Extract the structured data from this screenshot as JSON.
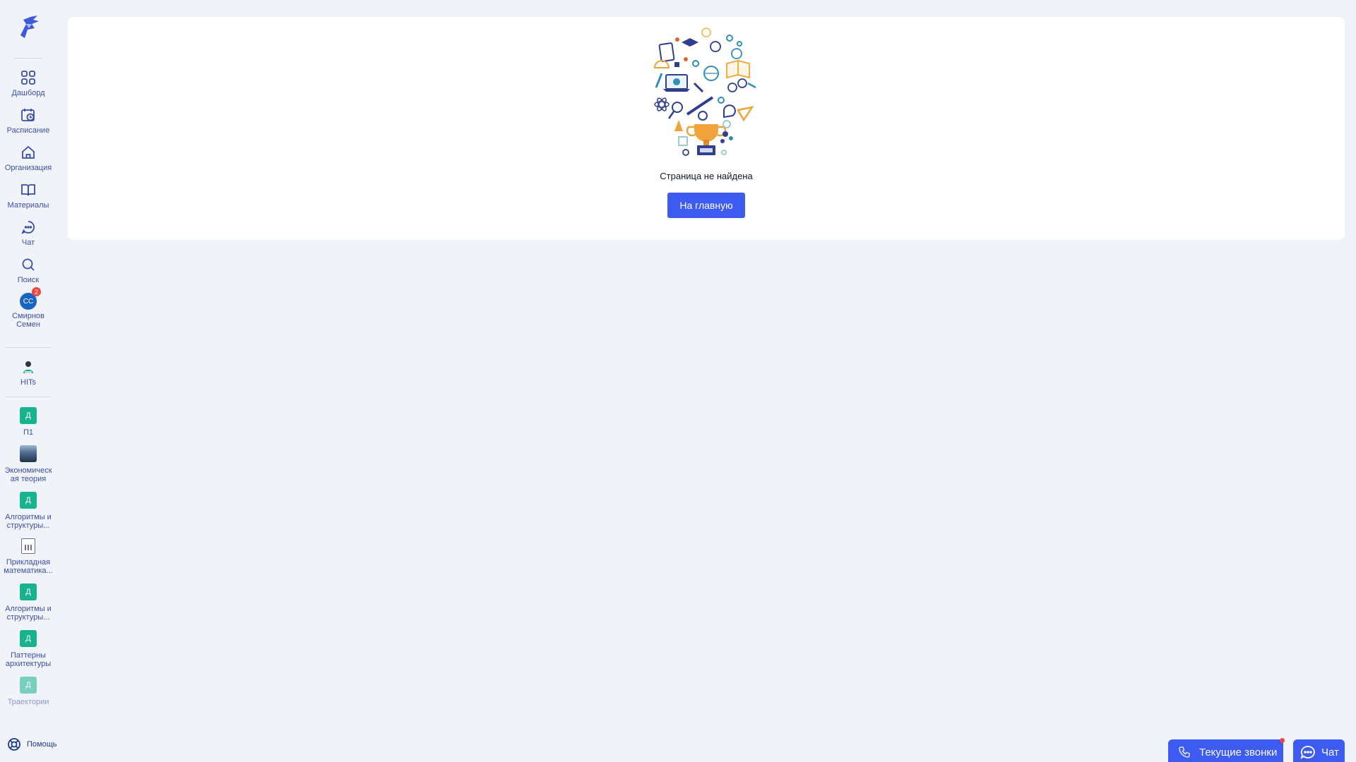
{
  "sidebar": {
    "nav": [
      {
        "label": "Дашборд",
        "icon": "grid-icon"
      },
      {
        "label": "Расписание",
        "icon": "calendar-clock-icon"
      },
      {
        "label": "Организация",
        "icon": "home-icon"
      },
      {
        "label": "Материалы",
        "icon": "book-icon"
      },
      {
        "label": "Чат",
        "icon": "chat-icon"
      },
      {
        "label": "Поиск",
        "icon": "search-icon"
      }
    ],
    "user": {
      "initials": "СС",
      "name": "Смирнов Семен",
      "badge": "2"
    },
    "org": {
      "label": "HITs"
    },
    "courses": [
      {
        "label": "П1",
        "tile": "Д"
      },
      {
        "label": "Экономическая теория"
      },
      {
        "label": "Алгоритмы и структуры...",
        "tile": "Д"
      },
      {
        "label": "Прикладная математика..."
      },
      {
        "label": "Алгоритмы и структуры...",
        "tile": "Д"
      },
      {
        "label": "Паттерны архитектуры",
        "tile": "Д"
      },
      {
        "label": "Траектории",
        "tile": "Д"
      }
    ],
    "help": "Помощь"
  },
  "main": {
    "message": "Страница не найдена",
    "home_button": "На главную"
  },
  "footer": {
    "calls_button": "Текущие звонки",
    "chat_button": "Чат"
  },
  "colors": {
    "accent": "#3d5af1",
    "sidebar_text": "#3b4ea3",
    "course_tile": "#18b28e",
    "background": "#f0f4f8"
  }
}
